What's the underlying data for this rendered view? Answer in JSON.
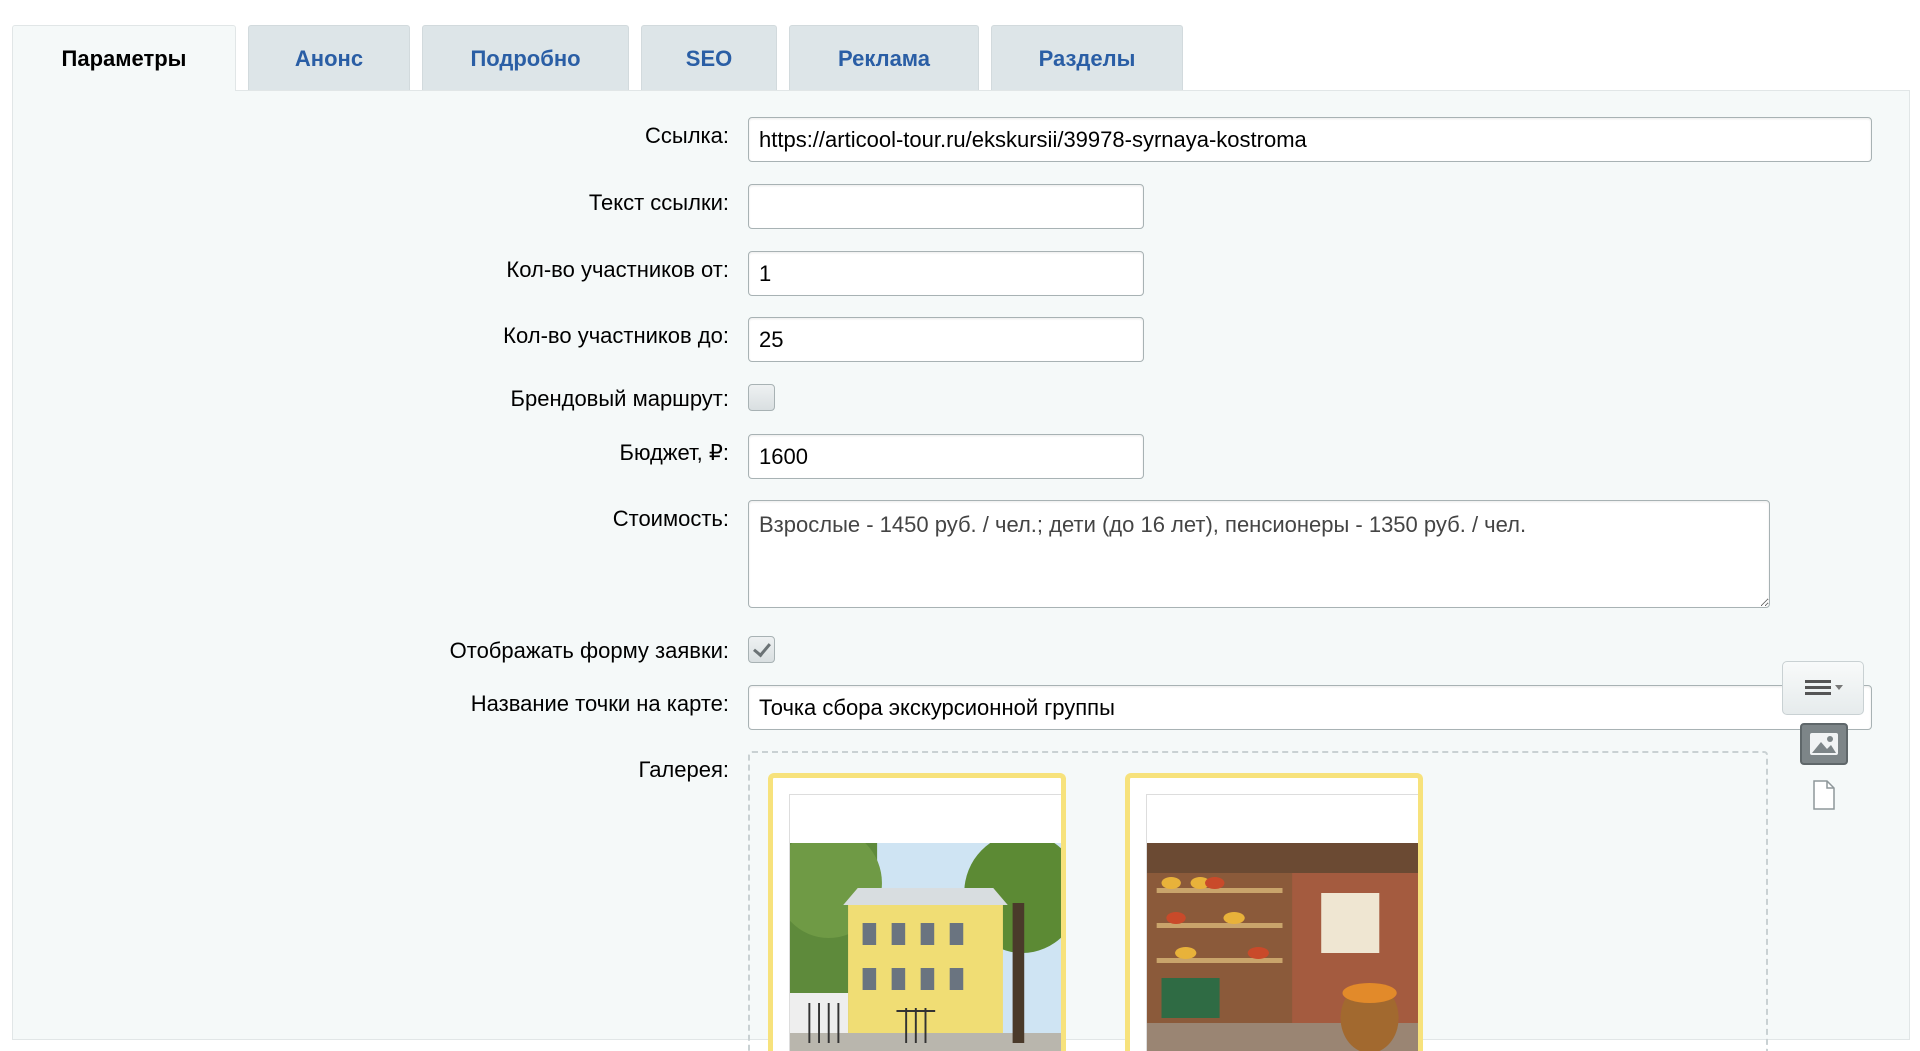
{
  "tabs": [
    {
      "label": "Параметры",
      "active": true
    },
    {
      "label": "Анонс"
    },
    {
      "label": "Подробно"
    },
    {
      "label": "SEO"
    },
    {
      "label": "Реклама"
    },
    {
      "label": "Разделы"
    }
  ],
  "form": {
    "link": {
      "label": "Ссылка:",
      "value": "https://articool-tour.ru/ekskursii/39978-syrnaya-kostroma"
    },
    "link_text": {
      "label": "Текст ссылки:",
      "value": ""
    },
    "participants_from": {
      "label": "Кол-во участников от:",
      "value": "1"
    },
    "participants_to": {
      "label": "Кол-во участников до:",
      "value": "25"
    },
    "brand_route": {
      "label": "Брендовый маршрут:",
      "checked": false
    },
    "budget": {
      "label": "Бюджет, ₽:",
      "value": "1600"
    },
    "cost": {
      "label": "Стоимость:",
      "value": "Взрослые - 1450 руб. / чел.; дети (до 16 лет), пенсионеры - 1350 руб. / чел."
    },
    "show_form": {
      "label": "Отображать форму заявки:",
      "checked": true
    },
    "map_point": {
      "label": "Название точки на карте:",
      "value": "Точка сбора экскурсионной группы"
    },
    "gallery": {
      "label": "Галерея:"
    }
  },
  "gallery": {
    "images": [
      "yellow-building-photo",
      "cheese-shop-interior-photo"
    ]
  },
  "icons": {
    "menu": "list-menu-icon",
    "image": "image-icon",
    "file": "file-icon"
  },
  "colors": {
    "tab_text": "#2a5ea5",
    "tab_bg": "#dde5e8",
    "panel_bg": "#f5f9f9",
    "thumb_border": "#f7e27c"
  }
}
